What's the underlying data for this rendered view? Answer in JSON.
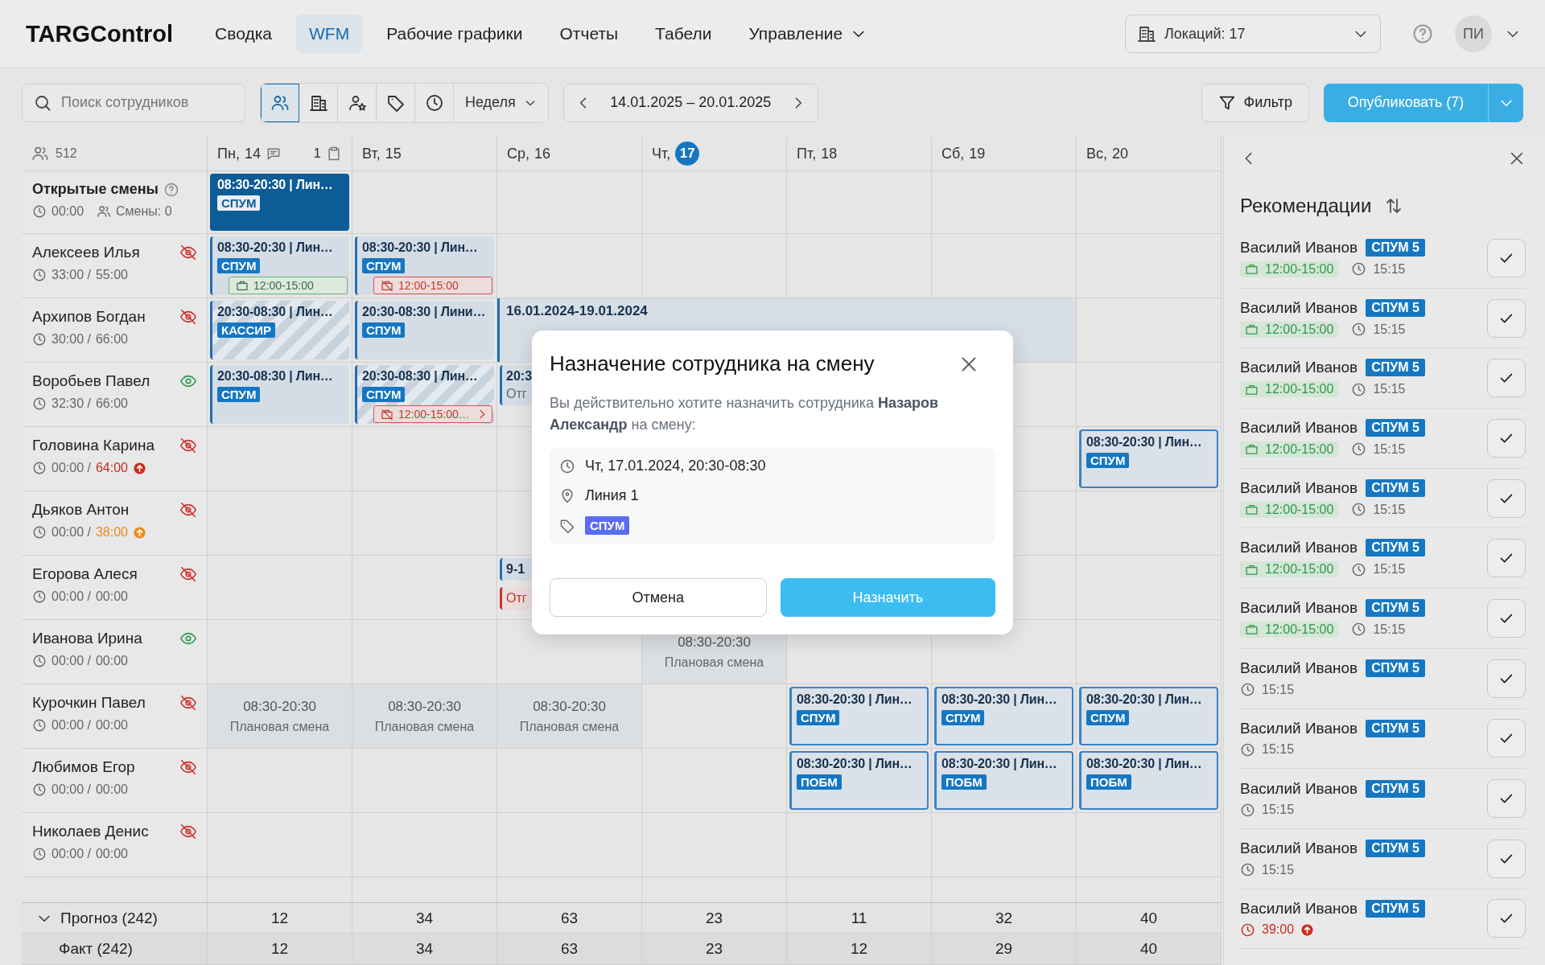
{
  "app": {
    "logo": "TARGControl",
    "nav": [
      {
        "label": "Сводка",
        "selected": false,
        "dropdown": false
      },
      {
        "label": "WFM",
        "selected": true,
        "dropdown": false
      },
      {
        "label": "Рабочие графики",
        "selected": false,
        "dropdown": false
      },
      {
        "label": "Отчеты",
        "selected": false,
        "dropdown": false
      },
      {
        "label": "Табели",
        "selected": false,
        "dropdown": false
      },
      {
        "label": "Управление",
        "selected": false,
        "dropdown": true
      }
    ],
    "location": "Локаций: 17",
    "avatar": "ПИ"
  },
  "toolbar": {
    "search": {
      "placeholder": "Поиск сотрудников"
    },
    "views": [
      {
        "kind": "users",
        "selected": true
      },
      {
        "kind": "building",
        "selected": false
      },
      {
        "kind": "userstar",
        "selected": false
      },
      {
        "kind": "tag",
        "selected": false
      },
      {
        "kind": "clock",
        "selected": false
      }
    ],
    "period": "Неделя",
    "date_range": "14.01.2025 – 20.01.2025",
    "filter": "Фильтр",
    "publish": "Опубликовать (7)"
  },
  "schedule": {
    "employee_count": "512",
    "days": [
      {
        "label": "Пн,",
        "date": "14",
        "today": false,
        "note_count": "1"
      },
      {
        "label": "Вт,",
        "date": "15",
        "today": false
      },
      {
        "label": "Ср,",
        "date": "16",
        "today": false
      },
      {
        "label": "Чт,",
        "date": "17",
        "today": true
      },
      {
        "label": "Пт,",
        "date": "18",
        "today": false
      },
      {
        "label": "Сб,",
        "date": "19",
        "today": false
      },
      {
        "label": "Вс,",
        "date": "20",
        "today": false
      }
    ],
    "open_shifts": {
      "title": "Открытые смены",
      "hours": "00:00",
      "shifts": "Смены: 0",
      "cells": [
        {
          "kind": "open",
          "title": "08:30-20:30 | Лин…",
          "tag": "СПУМ"
        },
        {
          "kind": "empty"
        },
        {
          "kind": "empty"
        },
        {
          "kind": "empty"
        },
        {
          "kind": "empty"
        },
        {
          "kind": "empty"
        },
        {
          "kind": "empty"
        }
      ]
    },
    "employees": [
      {
        "name": "Алексеев Илья",
        "visible": false,
        "worked": "33:00 /",
        "limit": "55:00",
        "limit_over": false,
        "limit_warning": false,
        "cells": [
          {
            "kind": "shift",
            "title": "08:30-20:30 | Лин…",
            "tag": "СПУМ",
            "hatched": false,
            "outlined": false,
            "note": {
              "available": true,
              "text": "12:00-15:00",
              "more": false
            }
          },
          {
            "kind": "shift",
            "title": "08:30-20:30 | Лин…",
            "tag": "СПУМ",
            "hatched": false,
            "outlined": false,
            "note": {
              "available": false,
              "text": "12:00-15:00",
              "more": false
            }
          },
          {
            "kind": "empty"
          },
          {
            "kind": "empty"
          },
          {
            "kind": "empty"
          },
          {
            "kind": "empty"
          },
          {
            "kind": "empty"
          }
        ]
      },
      {
        "name": "Архипов Богдан",
        "visible": false,
        "worked": "30:00 /",
        "limit": "66:00",
        "limit_over": false,
        "limit_warning": false,
        "cells": [
          {
            "kind": "shift",
            "title": "20:30-08:30 | Лин…",
            "tag": "КАССИР",
            "hatched": true,
            "outlined": false
          },
          {
            "kind": "shift",
            "title": "20:30-08:30 | Лини…",
            "tag": "СПУМ",
            "hatched": false,
            "outlined": false
          },
          {
            "kind": "trip",
            "title": "16.01.2024-19.01.2024"
          },
          {
            "kind": "continued"
          },
          {
            "kind": "continued"
          },
          {
            "kind": "continued"
          },
          {
            "kind": "empty"
          }
        ]
      },
      {
        "name": "Воробьев Павел",
        "visible": true,
        "worked": "32:30 /",
        "limit": "66:00",
        "limit_over": false,
        "limit_warning": false,
        "cells": [
          {
            "kind": "shift",
            "title": "20:30-08:30 | Лин…",
            "tag": "СПУМ",
            "hatched": false,
            "outlined": false
          },
          {
            "kind": "shift",
            "title": "20:30-08:30 | Лин…",
            "tag": "СПУМ",
            "hatched": true,
            "outlined": false,
            "note": {
              "available": false,
              "text": "12:00-15:00…",
              "more": true
            }
          },
          {
            "kind": "cut",
            "blocks": [
              {
                "absence": false,
                "lines": [
                  "20:3",
                  "Отг"
                ]
              }
            ]
          },
          {
            "kind": "empty"
          },
          {
            "kind": "empty"
          },
          {
            "kind": "empty"
          },
          {
            "kind": "empty"
          }
        ]
      },
      {
        "name": "Головина Карина",
        "visible": false,
        "worked": "00:00 /",
        "limit": "64:00",
        "limit_over": true,
        "limit_warning": false,
        "cells": [
          {
            "kind": "empty"
          },
          {
            "kind": "empty"
          },
          {
            "kind": "empty"
          },
          {
            "kind": "empty"
          },
          {
            "kind": "empty"
          },
          {
            "kind": "empty"
          },
          {
            "kind": "shift",
            "title": "08:30-20:30 | Лин…",
            "tag": "СПУМ",
            "hatched": false,
            "outlined": true
          }
        ]
      },
      {
        "name": "Дьяков Антон",
        "visible": false,
        "worked": "00:00 /",
        "limit": "38:00",
        "limit_over": false,
        "limit_warning": true,
        "cells": [
          {
            "kind": "empty"
          },
          {
            "kind": "empty"
          },
          {
            "kind": "empty"
          },
          {
            "kind": "empty"
          },
          {
            "kind": "empty"
          },
          {
            "kind": "empty"
          },
          {
            "kind": "empty"
          }
        ]
      },
      {
        "name": "Егорова Алеся",
        "visible": false,
        "worked": "00:00 /",
        "limit": "00:00",
        "limit_over": false,
        "limit_warning": false,
        "cells": [
          {
            "kind": "empty"
          },
          {
            "kind": "empty"
          },
          {
            "kind": "cut",
            "blocks": [
              {
                "absence": false,
                "lines": [
                  "9-1"
                ]
              },
              {
                "absence": true,
                "lines": [
                  "Отг"
                ]
              }
            ]
          },
          {
            "kind": "empty"
          },
          {
            "kind": "empty"
          },
          {
            "kind": "empty"
          },
          {
            "kind": "empty"
          }
        ]
      },
      {
        "name": "Иванова Ирина",
        "visible": true,
        "worked": "00:00 /",
        "limit": "00:00",
        "limit_over": false,
        "limit_warning": false,
        "cells": [
          {
            "kind": "empty"
          },
          {
            "kind": "empty"
          },
          {
            "kind": "empty"
          },
          {
            "kind": "plan",
            "time": "08:30-20:30",
            "label": "Плановая смена"
          },
          {
            "kind": "empty"
          },
          {
            "kind": "empty"
          },
          {
            "kind": "empty"
          }
        ]
      },
      {
        "name": "Курочкин Павел",
        "visible": false,
        "worked": "00:00 /",
        "limit": "00:00",
        "limit_over": false,
        "limit_warning": false,
        "cells": [
          {
            "kind": "plan",
            "time": "08:30-20:30",
            "label": "Плановая смена"
          },
          {
            "kind": "plan",
            "time": "08:30-20:30",
            "label": "Плановая смена"
          },
          {
            "kind": "plan",
            "time": "08:30-20:30",
            "label": "Плановая смена"
          },
          {
            "kind": "empty"
          },
          {
            "kind": "shift",
            "title": "08:30-20:30 | Лин…",
            "tag": "СПУМ",
            "hatched": false,
            "outlined": true
          },
          {
            "kind": "shift",
            "title": "08:30-20:30 | Лин…",
            "tag": "СПУМ",
            "hatched": false,
            "outlined": true
          },
          {
            "kind": "shift",
            "title": "08:30-20:30 | Лин…",
            "tag": "СПУМ",
            "hatched": false,
            "outlined": true
          }
        ]
      },
      {
        "name": "Любимов Егор",
        "visible": false,
        "worked": "00:00 /",
        "limit": "00:00",
        "limit_over": false,
        "limit_warning": false,
        "cells": [
          {
            "kind": "empty"
          },
          {
            "kind": "empty"
          },
          {
            "kind": "empty"
          },
          {
            "kind": "empty"
          },
          {
            "kind": "shift",
            "title": "08:30-20:30 | Лин…",
            "tag": "ПОБМ",
            "hatched": false,
            "outlined": true
          },
          {
            "kind": "shift",
            "title": "08:30-20:30 | Лин…",
            "tag": "ПОБМ",
            "hatched": false,
            "outlined": true
          },
          {
            "kind": "shift",
            "title": "08:30-20:30 | Лин…",
            "tag": "ПОБМ",
            "hatched": false,
            "outlined": true
          }
        ]
      },
      {
        "name": "Николаев Денис",
        "visible": false,
        "worked": "00:00 /",
        "limit": "00:00",
        "limit_over": false,
        "limit_warning": false,
        "cells": [
          {
            "kind": "empty"
          },
          {
            "kind": "empty"
          },
          {
            "kind": "empty"
          },
          {
            "kind": "empty"
          },
          {
            "kind": "empty"
          },
          {
            "kind": "empty"
          },
          {
            "kind": "empty"
          }
        ]
      }
    ],
    "totals": [
      {
        "label": "Прогноз (242)",
        "expanded": true,
        "values": [
          "12",
          "34",
          "63",
          "23",
          "11",
          "32",
          "40"
        ]
      },
      {
        "label": "Факт (242)",
        "values": [
          "12",
          "34",
          "63",
          "23",
          "12",
          "29",
          "40"
        ]
      }
    ]
  },
  "recommendations": {
    "title": "Рекомендации",
    "items": [
      {
        "name": "Василий Иванов",
        "tag": "СПУМ 5",
        "slot": "12:00-15:00",
        "hours": "15:15",
        "over": false
      },
      {
        "name": "Василий Иванов",
        "tag": "СПУМ 5",
        "slot": "12:00-15:00",
        "hours": "15:15",
        "over": false
      },
      {
        "name": "Василий Иванов",
        "tag": "СПУМ 5",
        "slot": "12:00-15:00",
        "hours": "15:15",
        "over": false
      },
      {
        "name": "Василий Иванов",
        "tag": "СПУМ 5",
        "slot": "12:00-15:00",
        "hours": "15:15",
        "over": false
      },
      {
        "name": "Василий Иванов",
        "tag": "СПУМ 5",
        "slot": "12:00-15:00",
        "hours": "15:15",
        "over": false
      },
      {
        "name": "Василий Иванов",
        "tag": "СПУМ 5",
        "slot": "12:00-15:00",
        "hours": "15:15",
        "over": false
      },
      {
        "name": "Василий Иванов",
        "tag": "СПУМ 5",
        "slot": "12:00-15:00",
        "hours": "15:15",
        "over": false
      },
      {
        "name": "Василий Иванов",
        "tag": "СПУМ 5",
        "hours": "15:15",
        "over": false
      },
      {
        "name": "Василий Иванов",
        "tag": "СПУМ 5",
        "hours": "15:15",
        "over": false
      },
      {
        "name": "Василий Иванов",
        "tag": "СПУМ 5",
        "hours": "15:15",
        "over": false
      },
      {
        "name": "Василий Иванов",
        "tag": "СПУМ 5",
        "hours": "15:15",
        "over": false
      },
      {
        "name": "Василий Иванов",
        "tag": "СПУМ 5",
        "hours": "39:00",
        "over": true
      }
    ]
  },
  "dialog": {
    "title": "Назначение сотрудника на смену",
    "text": "Вы действительно хотите назначить сотрудника **Назаров Александр** на смену:",
    "date": "Чт, 17.01.2024, 20:30-08:30",
    "location": "Линия 1",
    "tag": "СПУМ",
    "cancel": "Отмена",
    "confirm": "Назначить"
  }
}
